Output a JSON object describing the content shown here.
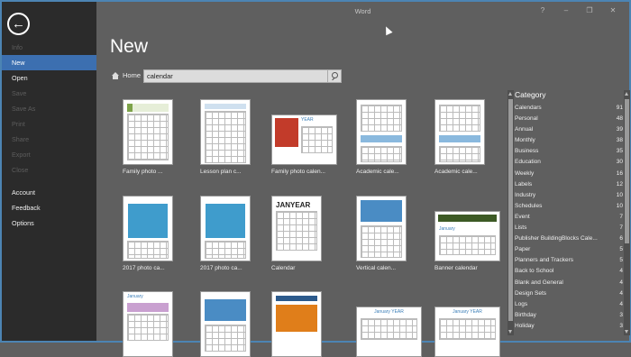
{
  "app": {
    "title": "Word"
  },
  "window_controls": [
    "?",
    "–",
    "❐",
    "✕"
  ],
  "sidebar": {
    "back_label": "←",
    "items": [
      {
        "label": "Info",
        "state": "disabled"
      },
      {
        "label": "New",
        "state": "active"
      },
      {
        "label": "Open",
        "state": "normal"
      },
      {
        "label": "Save",
        "state": "disabled"
      },
      {
        "label": "Save As",
        "state": "disabled"
      },
      {
        "label": "Print",
        "state": "disabled"
      },
      {
        "label": "Share",
        "state": "disabled"
      },
      {
        "label": "Export",
        "state": "disabled"
      },
      {
        "label": "Close",
        "state": "disabled"
      },
      {
        "label": "Account",
        "state": "normal"
      },
      {
        "label": "Feedback",
        "state": "normal"
      },
      {
        "label": "Options",
        "state": "normal"
      }
    ]
  },
  "main": {
    "title": "New",
    "home_label": "Home",
    "search": {
      "value": "calendar",
      "placeholder": ""
    }
  },
  "templates": [
    {
      "label": "Family photo ...",
      "style": "green-header"
    },
    {
      "label": "Lesson plan c...",
      "style": "lesson"
    },
    {
      "label": "Family photo calen...",
      "style": "photo-red"
    },
    {
      "label": "Academic cale...",
      "style": "academic"
    },
    {
      "label": "Academic cale...",
      "style": "academic"
    },
    {
      "label": "2017 photo ca...",
      "style": "photo-blue"
    },
    {
      "label": "2017 photo ca...",
      "style": "photo-blue"
    },
    {
      "label": "Calendar",
      "style": "janyear"
    },
    {
      "label": "Vertical calen...",
      "style": "vertical"
    },
    {
      "label": "Banner calendar",
      "style": "banner"
    },
    {
      "label": "",
      "style": "pink"
    },
    {
      "label": "",
      "style": "people"
    },
    {
      "label": "",
      "style": "orange"
    },
    {
      "label": "",
      "style": "janyear-wide"
    },
    {
      "label": "",
      "style": "janyear-wide"
    }
  ],
  "thumb_text": {
    "janyear": "JANYEAR",
    "year": "YEAR",
    "january": "January",
    "january_year": "January YEAR"
  },
  "category": {
    "title": "Category",
    "items": [
      {
        "name": "Calendars",
        "count": "91"
      },
      {
        "name": "Personal",
        "count": "48"
      },
      {
        "name": "Annual",
        "count": "39"
      },
      {
        "name": "Monthly",
        "count": "38"
      },
      {
        "name": "Business",
        "count": "35"
      },
      {
        "name": "Education",
        "count": "30"
      },
      {
        "name": "Weekly",
        "count": "16"
      },
      {
        "name": "Labels",
        "count": "12"
      },
      {
        "name": "Industry",
        "count": "10"
      },
      {
        "name": "Schedules",
        "count": "10"
      },
      {
        "name": "Event",
        "count": "7"
      },
      {
        "name": "Lists",
        "count": "7"
      },
      {
        "name": "Publisher BuildingBlocks Cale...",
        "count": "6"
      },
      {
        "name": "Paper",
        "count": "5"
      },
      {
        "name": "Planners and Trackers",
        "count": "5"
      },
      {
        "name": "Back to School",
        "count": "4"
      },
      {
        "name": "Blank and General",
        "count": "4"
      },
      {
        "name": "Design Sets",
        "count": "4"
      },
      {
        "name": "Logs",
        "count": "4"
      },
      {
        "name": "Birthday",
        "count": "3"
      },
      {
        "name": "Holiday",
        "count": "3"
      }
    ]
  }
}
